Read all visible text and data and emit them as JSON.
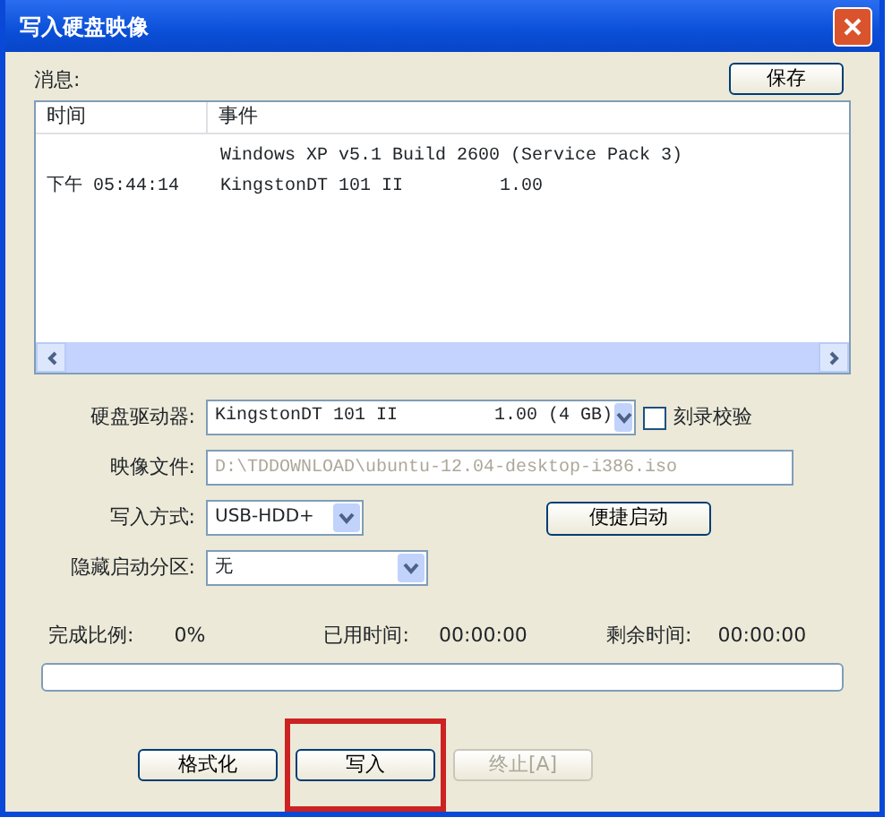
{
  "window": {
    "title": "写入硬盘映像"
  },
  "messages": {
    "label": "消息:",
    "save_button": "保存",
    "columns": [
      "时间",
      "事件"
    ],
    "rows": [
      {
        "time": "",
        "event": "Windows XP v5.1 Build 2600 (Service Pack 3)"
      },
      {
        "time": "下午 05:44:14",
        "event": "KingstonDT 101 II         1.00"
      }
    ]
  },
  "form": {
    "drive": {
      "label": "硬盘驱动器:",
      "value": "KingstonDT 101 II         1.00 (4 GB)"
    },
    "verify": {
      "label": "刻录校验",
      "checked": false
    },
    "image_file": {
      "label": "映像文件:",
      "value": "D:\\TDDOWNLOAD\\ubuntu-12.04-desktop-i386.iso",
      "disabled": true
    },
    "write_mode": {
      "label": "写入方式:",
      "value": "USB-HDD+"
    },
    "quick_boot_button": "便捷启动",
    "hidden_partition": {
      "label": "隐藏启动分区:",
      "value": "无"
    }
  },
  "progress": {
    "percent_label": "完成比例:",
    "percent": "0%",
    "elapsed_label": "已用时间:",
    "elapsed": "00:00:00",
    "remaining_label": "剩余时间:",
    "remaining": "00:00:00",
    "level": 0
  },
  "buttons": [
    {
      "label": "格式化",
      "disabled": false,
      "highlighted": false
    },
    {
      "label": "写入",
      "disabled": false,
      "highlighted": true
    },
    {
      "label": "终止[A]",
      "disabled": true,
      "highlighted": false
    }
  ]
}
